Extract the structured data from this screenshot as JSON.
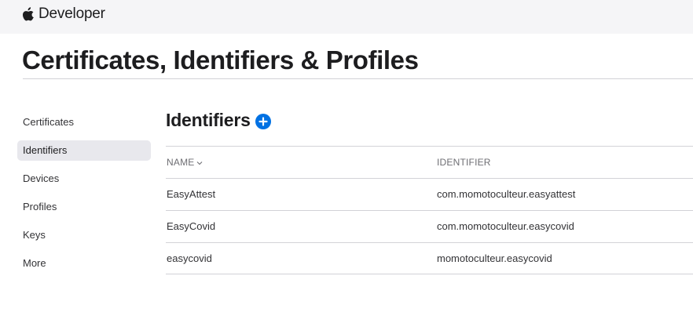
{
  "header": {
    "brand_label": "Developer",
    "logo_icon": "apple-logo-icon"
  },
  "page_title": "Certificates, Identifiers & Profiles",
  "sidebar": {
    "items": [
      {
        "label": "Certificates",
        "active": false
      },
      {
        "label": "Identifiers",
        "active": true
      },
      {
        "label": "Devices",
        "active": false
      },
      {
        "label": "Profiles",
        "active": false
      },
      {
        "label": "Keys",
        "active": false
      },
      {
        "label": "More",
        "active": false
      }
    ]
  },
  "section": {
    "title": "Identifiers",
    "add_icon": "plus-circle-icon",
    "accent_color": "#0071e3"
  },
  "table": {
    "columns": {
      "name": "NAME",
      "identifier": "IDENTIFIER",
      "sort_icon": "chevron-down-icon"
    },
    "rows": [
      {
        "name": "EasyAttest",
        "identifier": "com.momotoculteur.easyattest"
      },
      {
        "name": "EasyCovid",
        "identifier": "com.momotoculteur.easycovid"
      },
      {
        "name": "easycovid",
        "identifier": "momotoculteur.easycovid"
      }
    ]
  }
}
